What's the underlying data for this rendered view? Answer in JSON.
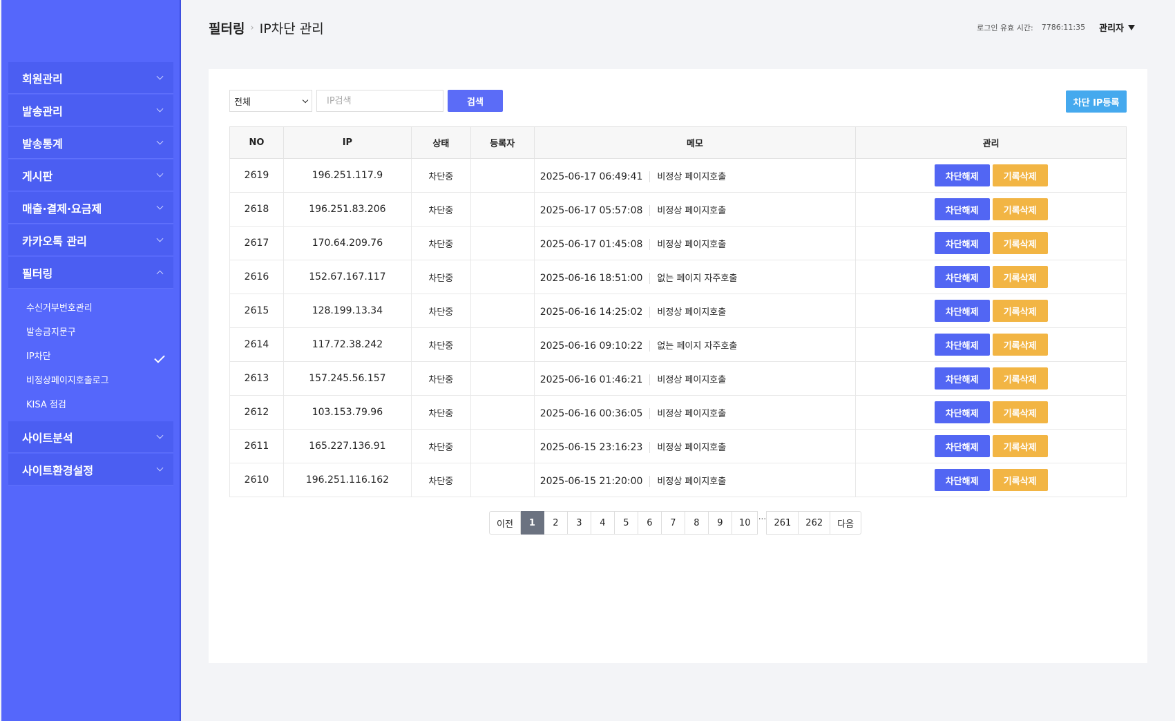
{
  "sidebar": {
    "menu_before": [
      {
        "label": "회원관리"
      },
      {
        "label": "발송관리"
      },
      {
        "label": "발송통계"
      },
      {
        "label": "게시판"
      },
      {
        "label": "매출·결제·요금제"
      },
      {
        "label": "카카오톡 관리"
      }
    ],
    "active_menu": {
      "label": "필터링"
    },
    "submenu": [
      {
        "label": "수신거부번호관리"
      },
      {
        "label": "발송금지문구"
      },
      {
        "label": "IP차단"
      },
      {
        "label": "비정상페이지호출로그"
      },
      {
        "label": "KISA 점검"
      }
    ],
    "menu_after": [
      {
        "label": "사이트분석"
      },
      {
        "label": "사이트환경설정"
      }
    ]
  },
  "header": {
    "breadcrumb_root": "필터링",
    "breadcrumb_sep": "›",
    "page_title": "IP차단 관리",
    "login_label": "로그인 유효 시간:",
    "login_time": "7786:11:35",
    "admin_label": "관리자"
  },
  "search": {
    "select_value": "전체",
    "input_placeholder": "IP검색",
    "search_button": "검색",
    "register_button": "차단 IP등록"
  },
  "table": {
    "headers": {
      "no": "NO",
      "ip": "IP",
      "status": "상태",
      "registrant": "등록자",
      "memo": "메모",
      "manage": "관리"
    },
    "unblock_label": "차단해제",
    "delete_label": "기록삭제",
    "rows": [
      {
        "no": "2619",
        "ip": "196.251.117.9",
        "status": "차단중",
        "registrant": "",
        "time": "2025-06-17 06:49:41",
        "memo": "비정상 페이지호출"
      },
      {
        "no": "2618",
        "ip": "196.251.83.206",
        "status": "차단중",
        "registrant": "",
        "time": "2025-06-17 05:57:08",
        "memo": "비정상 페이지호출"
      },
      {
        "no": "2617",
        "ip": "170.64.209.76",
        "status": "차단중",
        "registrant": "",
        "time": "2025-06-17 01:45:08",
        "memo": "비정상 페이지호출"
      },
      {
        "no": "2616",
        "ip": "152.67.167.117",
        "status": "차단중",
        "registrant": "",
        "time": "2025-06-16 18:51:00",
        "memo": "없는 페이지 자주호출"
      },
      {
        "no": "2615",
        "ip": "128.199.13.34",
        "status": "차단중",
        "registrant": "",
        "time": "2025-06-16 14:25:02",
        "memo": "비정상 페이지호출"
      },
      {
        "no": "2614",
        "ip": "117.72.38.242",
        "status": "차단중",
        "registrant": "",
        "time": "2025-06-16 09:10:22",
        "memo": "없는 페이지 자주호출"
      },
      {
        "no": "2613",
        "ip": "157.245.56.157",
        "status": "차단중",
        "registrant": "",
        "time": "2025-06-16 01:46:21",
        "memo": "비정상 페이지호출"
      },
      {
        "no": "2612",
        "ip": "103.153.79.96",
        "status": "차단중",
        "registrant": "",
        "time": "2025-06-16 00:36:05",
        "memo": "비정상 페이지호출"
      },
      {
        "no": "2611",
        "ip": "165.227.136.91",
        "status": "차단중",
        "registrant": "",
        "time": "2025-06-15 23:16:23",
        "memo": "비정상 페이지호출"
      },
      {
        "no": "2610",
        "ip": "196.251.116.162",
        "status": "차단중",
        "registrant": "",
        "time": "2025-06-15 21:20:00",
        "memo": "비정상 페이지호출"
      }
    ]
  },
  "pagination": {
    "prev": "이전",
    "pages": [
      "1",
      "2",
      "3",
      "4",
      "5",
      "6",
      "7",
      "8",
      "9",
      "10"
    ],
    "ellipsis": "...",
    "tail_pages": [
      "261",
      "262"
    ],
    "next": "다음",
    "current": "1"
  },
  "colors": {
    "sidebar": "#5567fb",
    "primary": "#5266f3",
    "warning": "#f2b544",
    "info": "#45a9ee"
  }
}
